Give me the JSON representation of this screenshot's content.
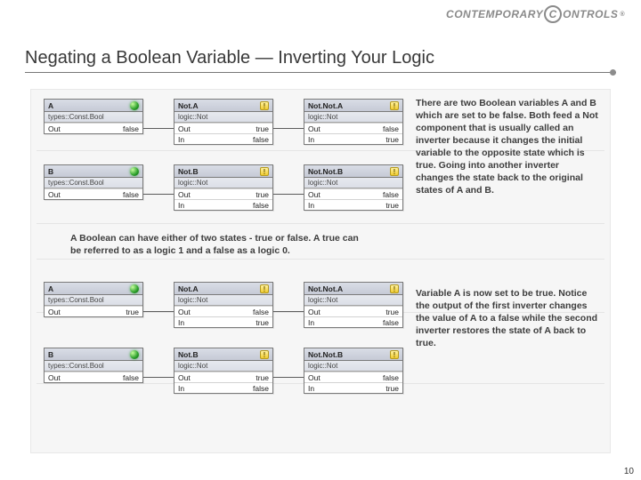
{
  "brand": {
    "left": "CONTEMPORARY",
    "right": "ONTROLS",
    "c": "C",
    "reg": "®"
  },
  "title": "Negating a Boolean Variable — Inverting Your Logic",
  "page_number": "10",
  "labels": {
    "types_bool": "types::Const.Bool",
    "logic_not": "logic::Not",
    "out": "Out",
    "in": "In",
    "true": "true",
    "false": "false"
  },
  "text1": "There are two Boolean variables A and B which are set to be false. Both feed a Not component that is usually called an inverter because it changes the initial variable to the opposite state which is true. Going into another inverter changes the state back to the original states of A and B.",
  "text2": "A Boolean can have either of two states - true or false. A true can be referred to as a logic 1 and a false as a logic 0.",
  "text3": "Variable A is now set to be true. Notice the output of the first inverter changes the value of A to a false while the second inverter restores the state of A back to true.",
  "top": {
    "rowA": {
      "src": {
        "name": "A",
        "out": "false"
      },
      "mid": {
        "name": "Not.A",
        "out": "true",
        "in": "false"
      },
      "last": {
        "name": "Not.Not.A",
        "out": "false",
        "in": "true"
      }
    },
    "rowB": {
      "src": {
        "name": "B",
        "out": "false"
      },
      "mid": {
        "name": "Not.B",
        "out": "true",
        "in": "false"
      },
      "last": {
        "name": "Not.Not.B",
        "out": "false",
        "in": "true"
      }
    }
  },
  "bottom": {
    "rowA": {
      "src": {
        "name": "A",
        "out": "true"
      },
      "mid": {
        "name": "Not.A",
        "out": "false",
        "in": "true"
      },
      "last": {
        "name": "Not.Not.A",
        "out": "true",
        "in": "false"
      }
    },
    "rowB": {
      "src": {
        "name": "B",
        "out": "false"
      },
      "mid": {
        "name": "Not.B",
        "out": "true",
        "in": "false"
      },
      "last": {
        "name": "Not.Not.B",
        "out": "false",
        "in": "true"
      }
    }
  }
}
